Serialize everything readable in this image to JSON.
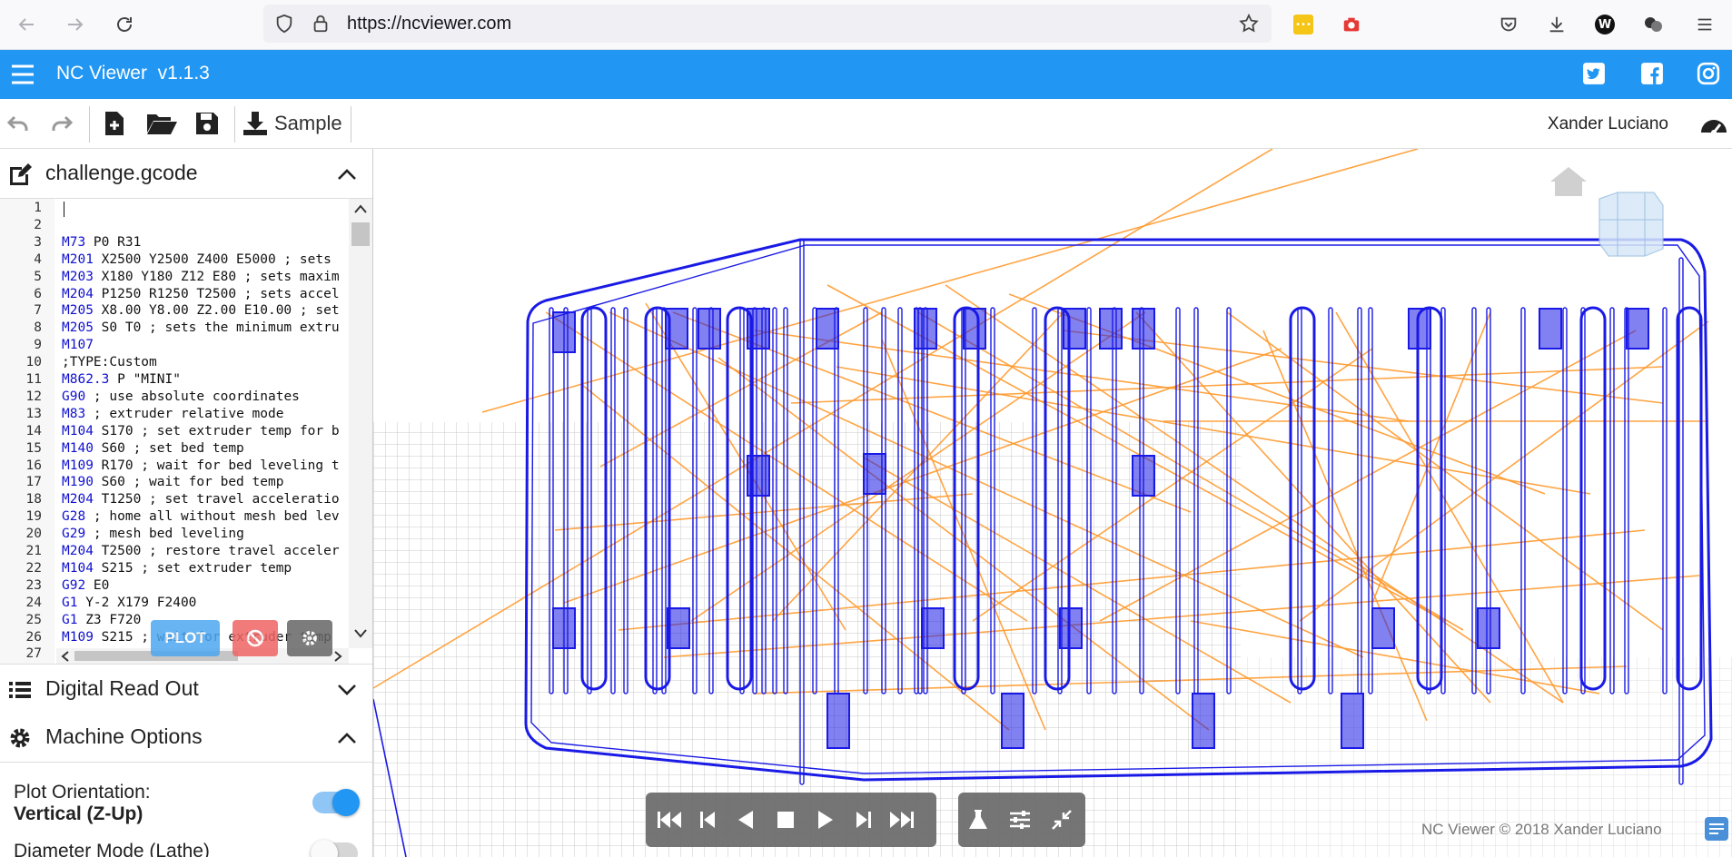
{
  "browser": {
    "url": "https://ncviewer.com"
  },
  "app": {
    "title": "NC Viewer  v1.1.3",
    "user": "Xander Luciano",
    "copyright": "NC Viewer © 2018 Xander Luciano",
    "accent_color": "#2196f3"
  },
  "toolbar": {
    "sample_label": "Sample"
  },
  "editor": {
    "file_name": "challenge.gcode",
    "lines": [
      {
        "n": "1",
        "cmd": "",
        "rest": ""
      },
      {
        "n": "2",
        "cmd": "",
        "rest": ""
      },
      {
        "n": "3",
        "cmd": "M73",
        "rest": " P0 R31"
      },
      {
        "n": "4",
        "cmd": "M201",
        "rest": " X2500 Y2500 Z400 E5000 ; sets"
      },
      {
        "n": "5",
        "cmd": "M203",
        "rest": " X180 Y180 Z12 E80 ; sets maxim"
      },
      {
        "n": "6",
        "cmd": "M204",
        "rest": " P1250 R1250 T2500 ; sets accel"
      },
      {
        "n": "7",
        "cmd": "M205",
        "rest": " X8.00 Y8.00 Z2.00 E10.00 ; set"
      },
      {
        "n": "8",
        "cmd": "M205",
        "rest": " S0 T0 ; sets the minimum extru"
      },
      {
        "n": "9",
        "cmd": "M107",
        "rest": ""
      },
      {
        "n": "10",
        "cmd": "",
        "rest": ";TYPE:Custom"
      },
      {
        "n": "11",
        "cmd": "M862.3",
        "rest": " P \"MINI\""
      },
      {
        "n": "12",
        "cmd": "G90",
        "rest": " ; use absolute coordinates"
      },
      {
        "n": "13",
        "cmd": "M83",
        "rest": " ; extruder relative mode"
      },
      {
        "n": "14",
        "cmd": "M104",
        "rest": " S170 ; set extruder temp for b"
      },
      {
        "n": "15",
        "cmd": "M140",
        "rest": " S60 ; set bed temp"
      },
      {
        "n": "16",
        "cmd": "M109",
        "rest": " R170 ; wait for bed leveling t"
      },
      {
        "n": "17",
        "cmd": "M190",
        "rest": " S60 ; wait for bed temp"
      },
      {
        "n": "18",
        "cmd": "M204",
        "rest": " T1250 ; set travel acceleratio"
      },
      {
        "n": "19",
        "cmd": "G28",
        "rest": " ; home all without mesh bed lev"
      },
      {
        "n": "20",
        "cmd": "G29",
        "rest": " ; mesh bed leveling"
      },
      {
        "n": "21",
        "cmd": "M204",
        "rest": " T2500 ; restore travel acceler"
      },
      {
        "n": "22",
        "cmd": "M104",
        "rest": " S215 ; set extruder temp"
      },
      {
        "n": "23",
        "cmd": "G92",
        "rest": " E0"
      },
      {
        "n": "24",
        "cmd": "G1",
        "rest": " Y-2 X179 F2400"
      },
      {
        "n": "25",
        "cmd": "G1",
        "rest": " Z3 F720"
      },
      {
        "n": "26",
        "cmd": "M109",
        "rest": " S215 ; wait for extruder temp"
      },
      {
        "n": "27",
        "cmd": "",
        "rest": ""
      }
    ],
    "plot_label": "PLOT"
  },
  "panels": {
    "dro_title": "Digital Read Out",
    "machine_title": "Machine Options"
  },
  "machine_options": {
    "plot_orientation_label": "Plot Orientation:",
    "plot_orientation_value": "Vertical (Z-Up)",
    "plot_orientation_on": true,
    "diameter_mode_label": "Diameter Mode (Lathe)",
    "diameter_mode_on": false
  },
  "colors": {
    "toolpath_cut": "#1a1ae6",
    "toolpath_travel": "#ff9a2e",
    "plot_button": "#4ea7f0",
    "clear_button": "#ef6464",
    "settings_button": "#666666"
  }
}
